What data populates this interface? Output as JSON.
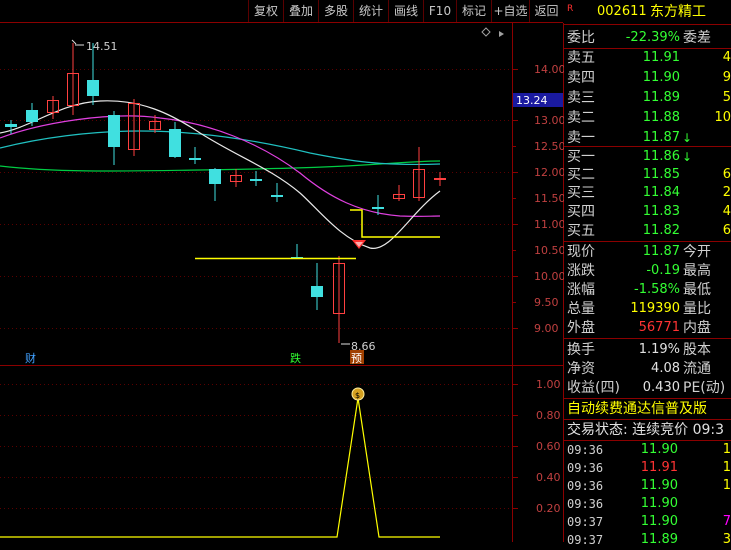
{
  "toolbar": {
    "buttons": [
      "复权",
      "叠加",
      "多股",
      "统计",
      "画线",
      "F10",
      "标记",
      "+自选",
      "返回"
    ]
  },
  "stock": {
    "badge": "R",
    "code": "002611",
    "name": "东方精工"
  },
  "price_axis": {
    "labels": [
      "14.00",
      "13.50",
      "13.00",
      "12.50",
      "12.00",
      "11.50",
      "11.00",
      "10.50",
      "10.00",
      "9.50",
      "9.00"
    ],
    "current_tag": "13.24"
  },
  "chart_annotations": {
    "high_label": "14.51",
    "low_label": "8.66",
    "marker_cai": "财",
    "marker_die": "跌",
    "marker_yu": "预"
  },
  "indicator_axis": {
    "labels": [
      "1.00",
      "0.80",
      "0.60",
      "0.40",
      "0.20"
    ]
  },
  "order_book": {
    "ratio_label": "委比",
    "ratio_value": "-22.39%",
    "diff_label": "委差",
    "asks": [
      {
        "label": "卖五",
        "price": "11.91",
        "vol": "4"
      },
      {
        "label": "卖四",
        "price": "11.90",
        "vol": "9"
      },
      {
        "label": "卖三",
        "price": "11.89",
        "vol": "5"
      },
      {
        "label": "卖二",
        "price": "11.88",
        "vol": "10"
      },
      {
        "label": "卖一",
        "price": "11.87",
        "vol": "",
        "arrow": "↓"
      }
    ],
    "bids": [
      {
        "label": "买一",
        "price": "11.86",
        "vol": "",
        "arrow": "↓"
      },
      {
        "label": "买二",
        "price": "11.85",
        "vol": "6"
      },
      {
        "label": "买三",
        "price": "11.84",
        "vol": "2"
      },
      {
        "label": "买四",
        "price": "11.83",
        "vol": "4"
      },
      {
        "label": "买五",
        "price": "11.82",
        "vol": "6"
      }
    ]
  },
  "quote": {
    "rows": [
      {
        "label": "现价",
        "value": "11.87",
        "label2": "今开"
      },
      {
        "label": "涨跌",
        "value": "-0.19",
        "label2": "最高"
      },
      {
        "label": "涨幅",
        "value": "-1.58%",
        "label2": "最低"
      },
      {
        "label": "总量",
        "value": "119390",
        "label2": "量比"
      },
      {
        "label": "外盘",
        "value": "56771",
        "label2": "内盘"
      }
    ]
  },
  "fundamentals": {
    "rows": [
      {
        "label": "换手",
        "value": "1.19%",
        "label2": "股本"
      },
      {
        "label": "净资",
        "value": "4.08",
        "label2": "流通"
      },
      {
        "label": "收益(四)",
        "value": "0.430",
        "label2": "PE(动)"
      }
    ]
  },
  "banner": "自动续费通达信普及版",
  "trade_status": "交易状态: 连续竞价 09:3",
  "ticks": [
    {
      "time": "09:36",
      "price": "11.90",
      "vol": "1"
    },
    {
      "time": "09:36",
      "price": "11.91",
      "vol": "1"
    },
    {
      "time": "09:36",
      "price": "11.90",
      "vol": "1"
    },
    {
      "time": "09:36",
      "price": "11.90",
      "vol": ""
    },
    {
      "time": "09:37",
      "price": "11.90",
      "vol": "7"
    },
    {
      "time": "09:37",
      "price": "11.89",
      "vol": "3"
    }
  ]
}
